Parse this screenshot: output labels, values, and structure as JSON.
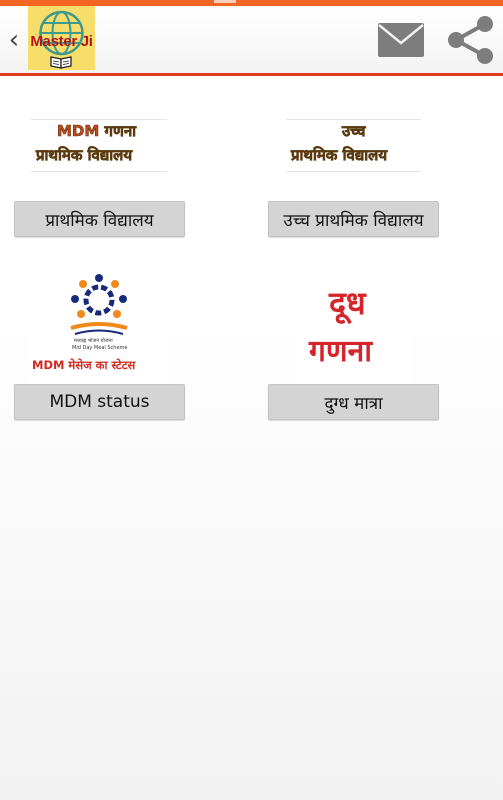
{
  "app": {
    "logo_text": "Master Ji",
    "colors": {
      "accent": "#f26522",
      "divider": "#e03a1e",
      "logo_bg": "#f7dd6a",
      "logo_text": "#b3141a",
      "milk_text": "#d6242a"
    }
  },
  "header": {
    "back_icon": "‹",
    "icons": [
      "back-icon",
      "globe-icon",
      "book-icon",
      "mail-icon",
      "share-icon"
    ]
  },
  "tiles": [
    {
      "image_line1": "MDM गणना",
      "image_line2": "प्राथमिक विद्यालय",
      "button_label": "प्राथमिक विद्यालय"
    },
    {
      "image_line1": "उच्च",
      "image_line2": "प्राथमिक विद्यालय",
      "button_label": "उच्च प्राथमिक विद्यालय"
    },
    {
      "image_small1": "मध्याह्न भोजन योजना",
      "image_small2": "Mid Day Meal Scheme",
      "image_line1": "MDM  मेसेज का स्टेटस",
      "button_label": "MDM status"
    },
    {
      "image_line1": "दूध",
      "image_line2": "गणना",
      "button_label": "दुग्ध मात्रा"
    }
  ]
}
